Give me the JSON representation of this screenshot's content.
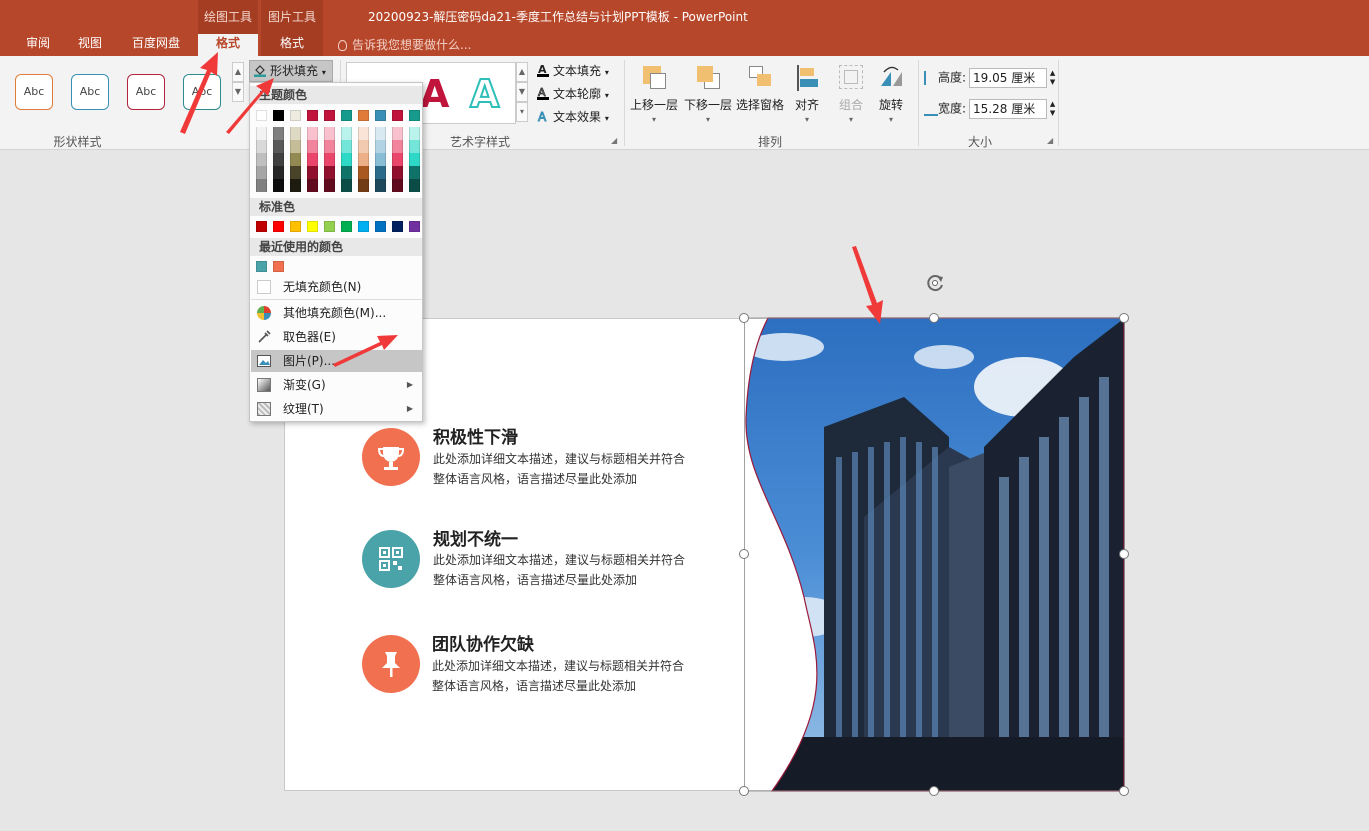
{
  "titlebar": {
    "document_title": "20200923-解压密码da21-季度工作总结与计划PPT模板 - PowerPoint",
    "context_groups": [
      {
        "label": "绘图工具",
        "tab": "格式"
      },
      {
        "label": "图片工具",
        "tab": "格式"
      }
    ],
    "tabs": [
      "审阅",
      "视图",
      "百度网盘"
    ],
    "tell_me": "告诉我您想要做什么..."
  },
  "ribbon": {
    "shape_styles": {
      "label": "形状样式",
      "sample_text": "Abc",
      "samples": [
        {
          "border": "#e07b39"
        },
        {
          "border": "#3a8fb7"
        },
        {
          "border": "#b0253e"
        },
        {
          "border": "#2e8b8b"
        }
      ],
      "shape_fill": "形状填充"
    },
    "wordart": {
      "label": "艺术字样式",
      "text_fill": "文本填充",
      "text_outline": "文本轮廓",
      "text_effect": "文本效果",
      "letter": "A"
    },
    "arrange": {
      "label": "排列",
      "bring_forward": "上移一层",
      "send_backward": "下移一层",
      "selection_pane": "选择窗格",
      "align": "对齐",
      "group": "组合",
      "rotate": "旋转"
    },
    "size": {
      "label": "大小",
      "height_label": "高度:",
      "height_value": "19.05 厘米",
      "width_label": "宽度:",
      "width_value": "15.28 厘米"
    }
  },
  "menu": {
    "theme_colors_label": "主题颜色",
    "standard_colors_label": "标准色",
    "recent_colors_label": "最近使用的颜色",
    "theme_top": [
      "#ffffff",
      "#000000",
      "#eeece1",
      "#c0143c",
      "#c0143c",
      "#159a8c",
      "#e07b39",
      "#3a8fb7",
      "#c0143c",
      "#159a8c"
    ],
    "theme_columns": [
      [
        "#f2f2f2",
        "#d9d9d9",
        "#bfbfbf",
        "#a6a6a6",
        "#808080"
      ],
      [
        "#7f7f7f",
        "#595959",
        "#404040",
        "#262626",
        "#0d0d0d"
      ],
      [
        "#ddd9c3",
        "#c4bd97",
        "#938953",
        "#494429",
        "#1d1b10"
      ],
      [
        "#f8c1cd",
        "#f1849c",
        "#ea466b",
        "#900f2d",
        "#600a1e"
      ],
      [
        "#f8c1cd",
        "#f1849c",
        "#ea466b",
        "#900f2d",
        "#600a1e"
      ],
      [
        "#b9f3ec",
        "#73e6d9",
        "#2dd9c6",
        "#107369",
        "#0b4d46"
      ],
      [
        "#f9e4d7",
        "#f2caaf",
        "#ecaf87",
        "#a9581f",
        "#713b15"
      ],
      [
        "#d8e9f1",
        "#b1d3e3",
        "#89bcd5",
        "#2b6a89",
        "#1d475b"
      ],
      [
        "#f8c1cd",
        "#f1849c",
        "#ea466b",
        "#900f2d",
        "#600a1e"
      ],
      [
        "#b9f3ec",
        "#73e6d9",
        "#2dd9c6",
        "#107369",
        "#0b4d46"
      ]
    ],
    "standard_colors": [
      "#c00000",
      "#ff0000",
      "#ffc000",
      "#ffff00",
      "#92d050",
      "#00b050",
      "#00b0f0",
      "#0070c0",
      "#002060",
      "#7030a0"
    ],
    "recent_colors": [
      "#4aa3a8",
      "#f07050"
    ],
    "no_fill": "无填充颜色(N)",
    "more_colors": "其他填充颜色(M)...",
    "eyedropper": "取色器(E)",
    "picture": "图片(P)...",
    "gradient": "渐变(G)",
    "texture": "纹理(T)"
  },
  "slide": {
    "items": [
      {
        "title": "积极性下滑",
        "desc": "此处添加详细文本描述，建议与标题相关并符合整体语言风格，语言描述尽量此处添加",
        "color": "#f07050",
        "icon": "trophy-icon"
      },
      {
        "title": "规划不统一",
        "desc": "此处添加详细文本描述，建议与标题相关并符合整体语言风格，语言描述尽量此处添加",
        "color": "#4aa3a8",
        "icon": "qr-code-icon"
      },
      {
        "title": "团队协作欠缺",
        "desc": "此处添加详细文本描述，建议与标题相关并符合整体语言风格，语言描述尽量此处添加",
        "color": "#f07050",
        "icon": "pushpin-icon"
      }
    ]
  },
  "colors": {
    "accent": "#b7472a",
    "annotation_arrow": "#f03a3a"
  }
}
